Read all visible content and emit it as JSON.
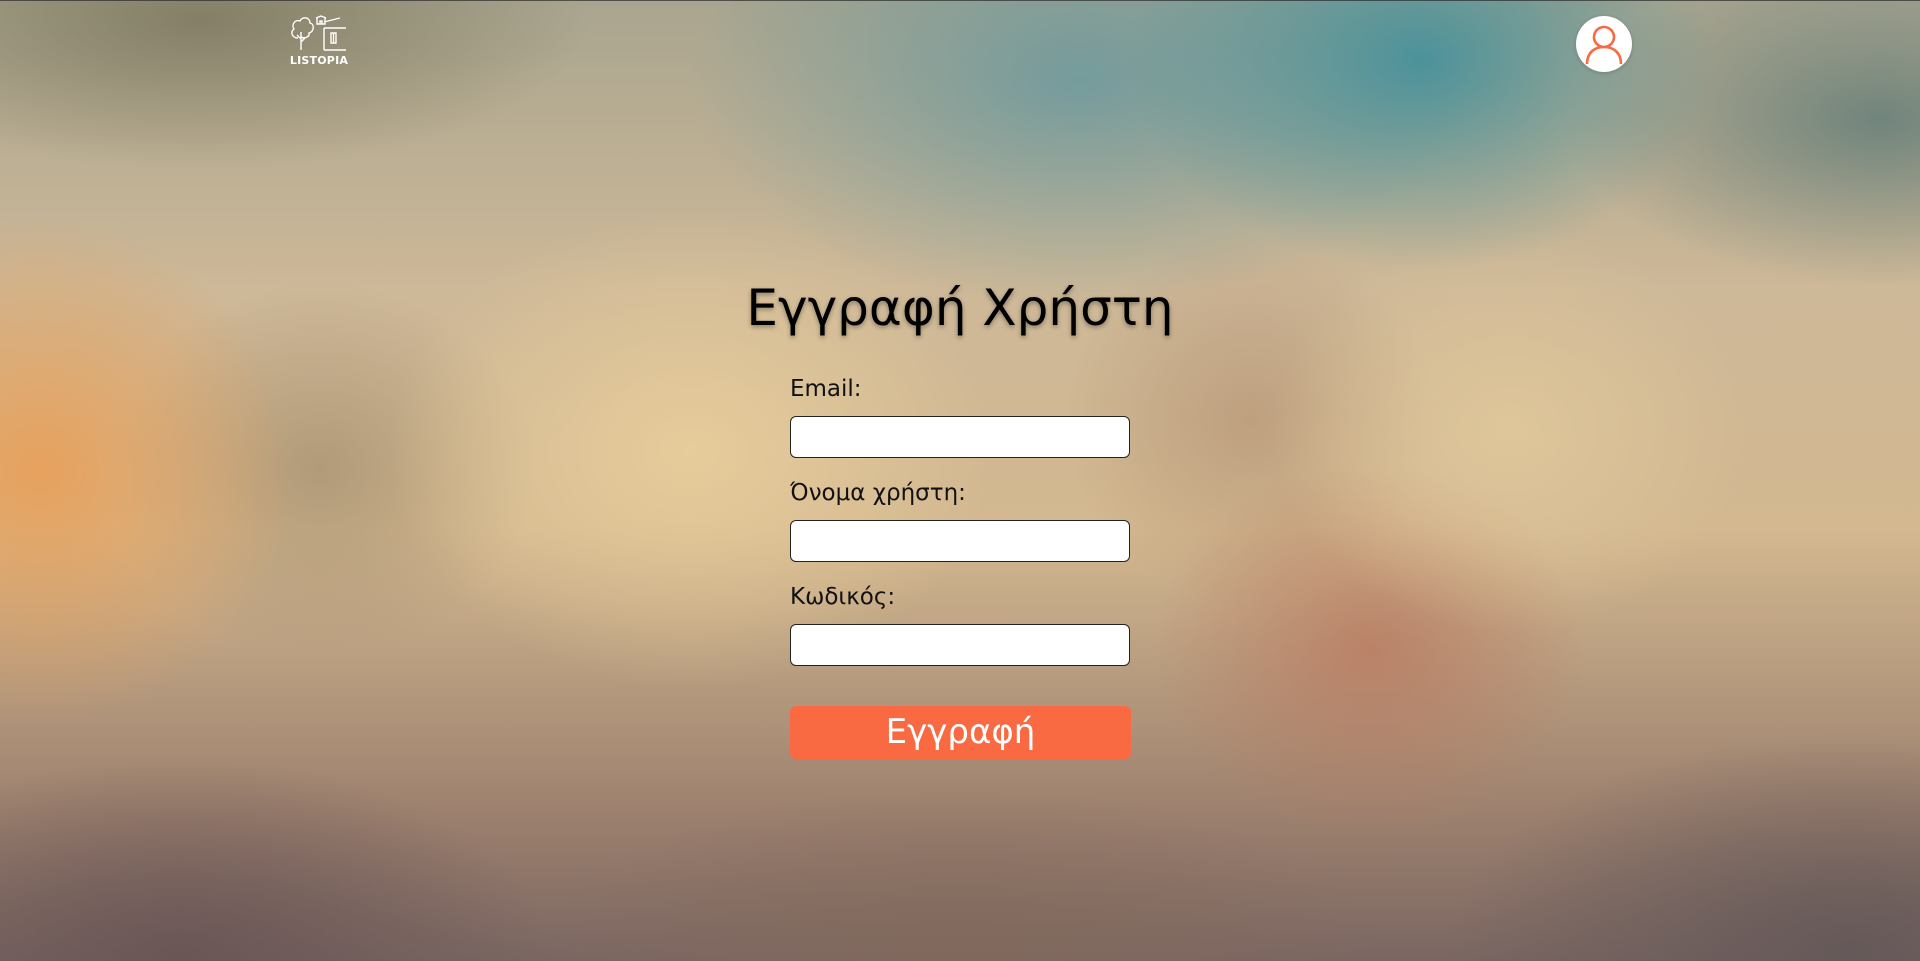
{
  "header": {
    "logo_text": "LISTOPIA",
    "logo_icon": "tree-house-logo-icon",
    "profile_icon": "user-icon"
  },
  "form": {
    "title": "Εγγραφή Χρήστη",
    "email_label": "Email:",
    "email_value": "",
    "username_label": "Όνομα χρήστη:",
    "username_value": "",
    "password_label": "Κωδικός:",
    "password_value": "",
    "submit_label": "Εγγραφή"
  },
  "colors": {
    "accent": "#f96a43",
    "text": "#000000",
    "input_background": "#ffffff",
    "teal_glow": "#46919b",
    "amber_glow": "#e8a05a"
  }
}
